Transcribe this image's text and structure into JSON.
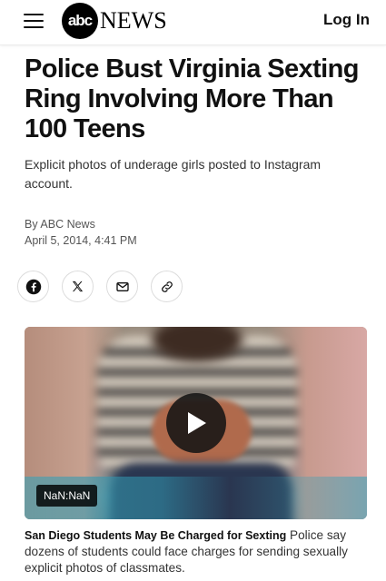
{
  "header": {
    "logo_mark": "abc",
    "logo_word": "NEWS",
    "login_label": "Log In"
  },
  "article": {
    "headline": "Police Bust Virginia Sexting Ring Involving More Than 100 Teens",
    "subheadline": "Explicit photos of underage girls posted to Instagram account.",
    "byline_prefix": "By",
    "author": "ABC News",
    "timestamp": "April 5, 2014, 4:41 PM"
  },
  "share": {
    "icons": [
      "facebook-icon",
      "x-icon",
      "email-icon",
      "link-icon"
    ]
  },
  "video": {
    "duration": "NaN:NaN",
    "caption_title": "San Diego Students May Be Charged for Sexting",
    "caption_text": "Police say dozens of students could face charges for sending sexually explicit photos of classmates."
  },
  "colors": {
    "text": "#111111",
    "muted": "#555555",
    "border": "#dcdcdc"
  }
}
